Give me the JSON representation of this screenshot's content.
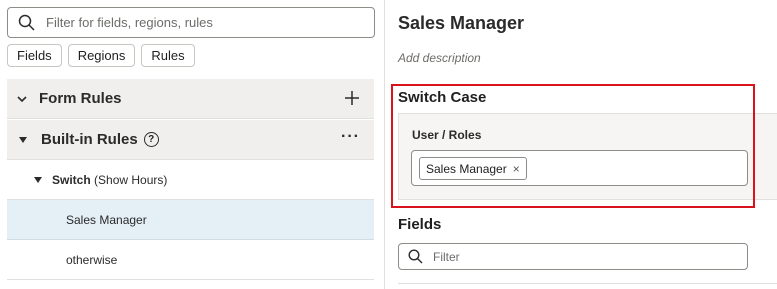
{
  "left": {
    "search": {
      "placeholder": "Filter for fields, regions, rules"
    },
    "chips": [
      "Fields",
      "Regions",
      "Rules"
    ],
    "form_rules": {
      "label": "Form Rules"
    },
    "builtin_rules": {
      "label": "Built-in Rules",
      "help": "?",
      "more": "···"
    },
    "switch": {
      "name": "Switch",
      "detail": "(Show Hours)"
    },
    "cases": [
      "Sales Manager",
      "otherwise"
    ]
  },
  "right": {
    "title": "Sales Manager",
    "description_placeholder": "Add description",
    "switch_case_label": "Switch Case",
    "user_roles_label": "User / Roles",
    "token": {
      "label": "Sales Manager",
      "remove": "×"
    },
    "fields_label": "Fields",
    "filter_placeholder": "Filter"
  },
  "colors": {
    "selected_row": "#e4eff6",
    "highlight": "#d8131b"
  }
}
